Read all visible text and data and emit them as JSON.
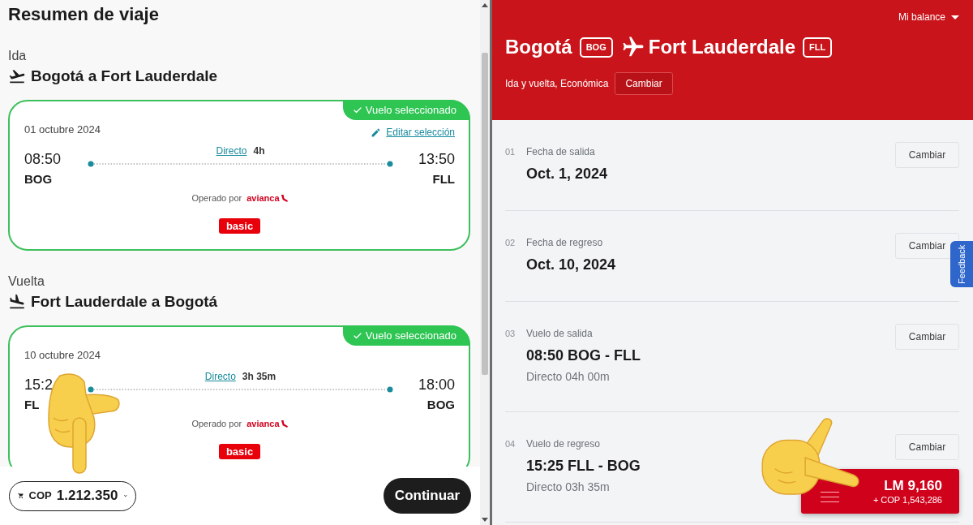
{
  "trip_summary": {
    "title": "Resumen de viaje",
    "legs": [
      {
        "direction": "Ida",
        "kind": "departure",
        "route": "Bogotá a Fort Lauderdale",
        "selected": true,
        "badge": "Vuelo seleccionado",
        "date": "01 octubre 2024",
        "edit_link": "Editar selección",
        "depart_time": "08:50",
        "depart_code": "BOG",
        "stops_link": "Directo",
        "duration": "4h",
        "arrive_time": "13:50",
        "arrive_code": "FLL",
        "operated_by": "Operado por",
        "airline": "avianca",
        "fare": "basic"
      },
      {
        "direction": "Vuelta",
        "kind": "return",
        "route": "Fort Lauderdale a Bogotá",
        "selected": true,
        "badge": "Vuelo seleccionado",
        "date": "10 octubre 2024",
        "depart_time": "15:2",
        "depart_code": "FL",
        "stops_link": "Directo",
        "duration": "3h 35m",
        "arrive_time": "18:00",
        "arrive_code": "BOG",
        "operated_by": "Operado por",
        "airline": "avianca",
        "fare": "basic"
      }
    ],
    "footer": {
      "currency": "COP",
      "total": "1.212.350",
      "continue_button": "Continuar"
    }
  },
  "booking_panel": {
    "balance_menu": "Mi balance",
    "origin_city": "Bogotá",
    "origin_code": "BOG",
    "destination_city": "Fort Lauderdale",
    "destination_code": "FLL",
    "trip_type": "Ida y vuelta, Económica",
    "change_button": "Cambiar",
    "steps": [
      {
        "number": "01",
        "label": "Fecha de salida",
        "value": "Oct. 1, 2024",
        "button": "Cambiar"
      },
      {
        "number": "02",
        "label": "Fecha de regreso",
        "value": "Oct. 10, 2024",
        "button": "Cambiar"
      },
      {
        "number": "03",
        "label": "Vuelo de salida",
        "value": "08:50 BOG - FLL",
        "detail": "Directo 04h 00m",
        "button": "Cambiar"
      },
      {
        "number": "04",
        "label": "Vuelo de regreso",
        "value": "15:25 FLL - BOG",
        "detail": "Directo 03h 35m",
        "button": "Cambiar"
      }
    ],
    "feedback_tab": "Feedback",
    "price_button": {
      "miles": "LM 9,160",
      "cash": "+ COP 1,543,286"
    }
  }
}
